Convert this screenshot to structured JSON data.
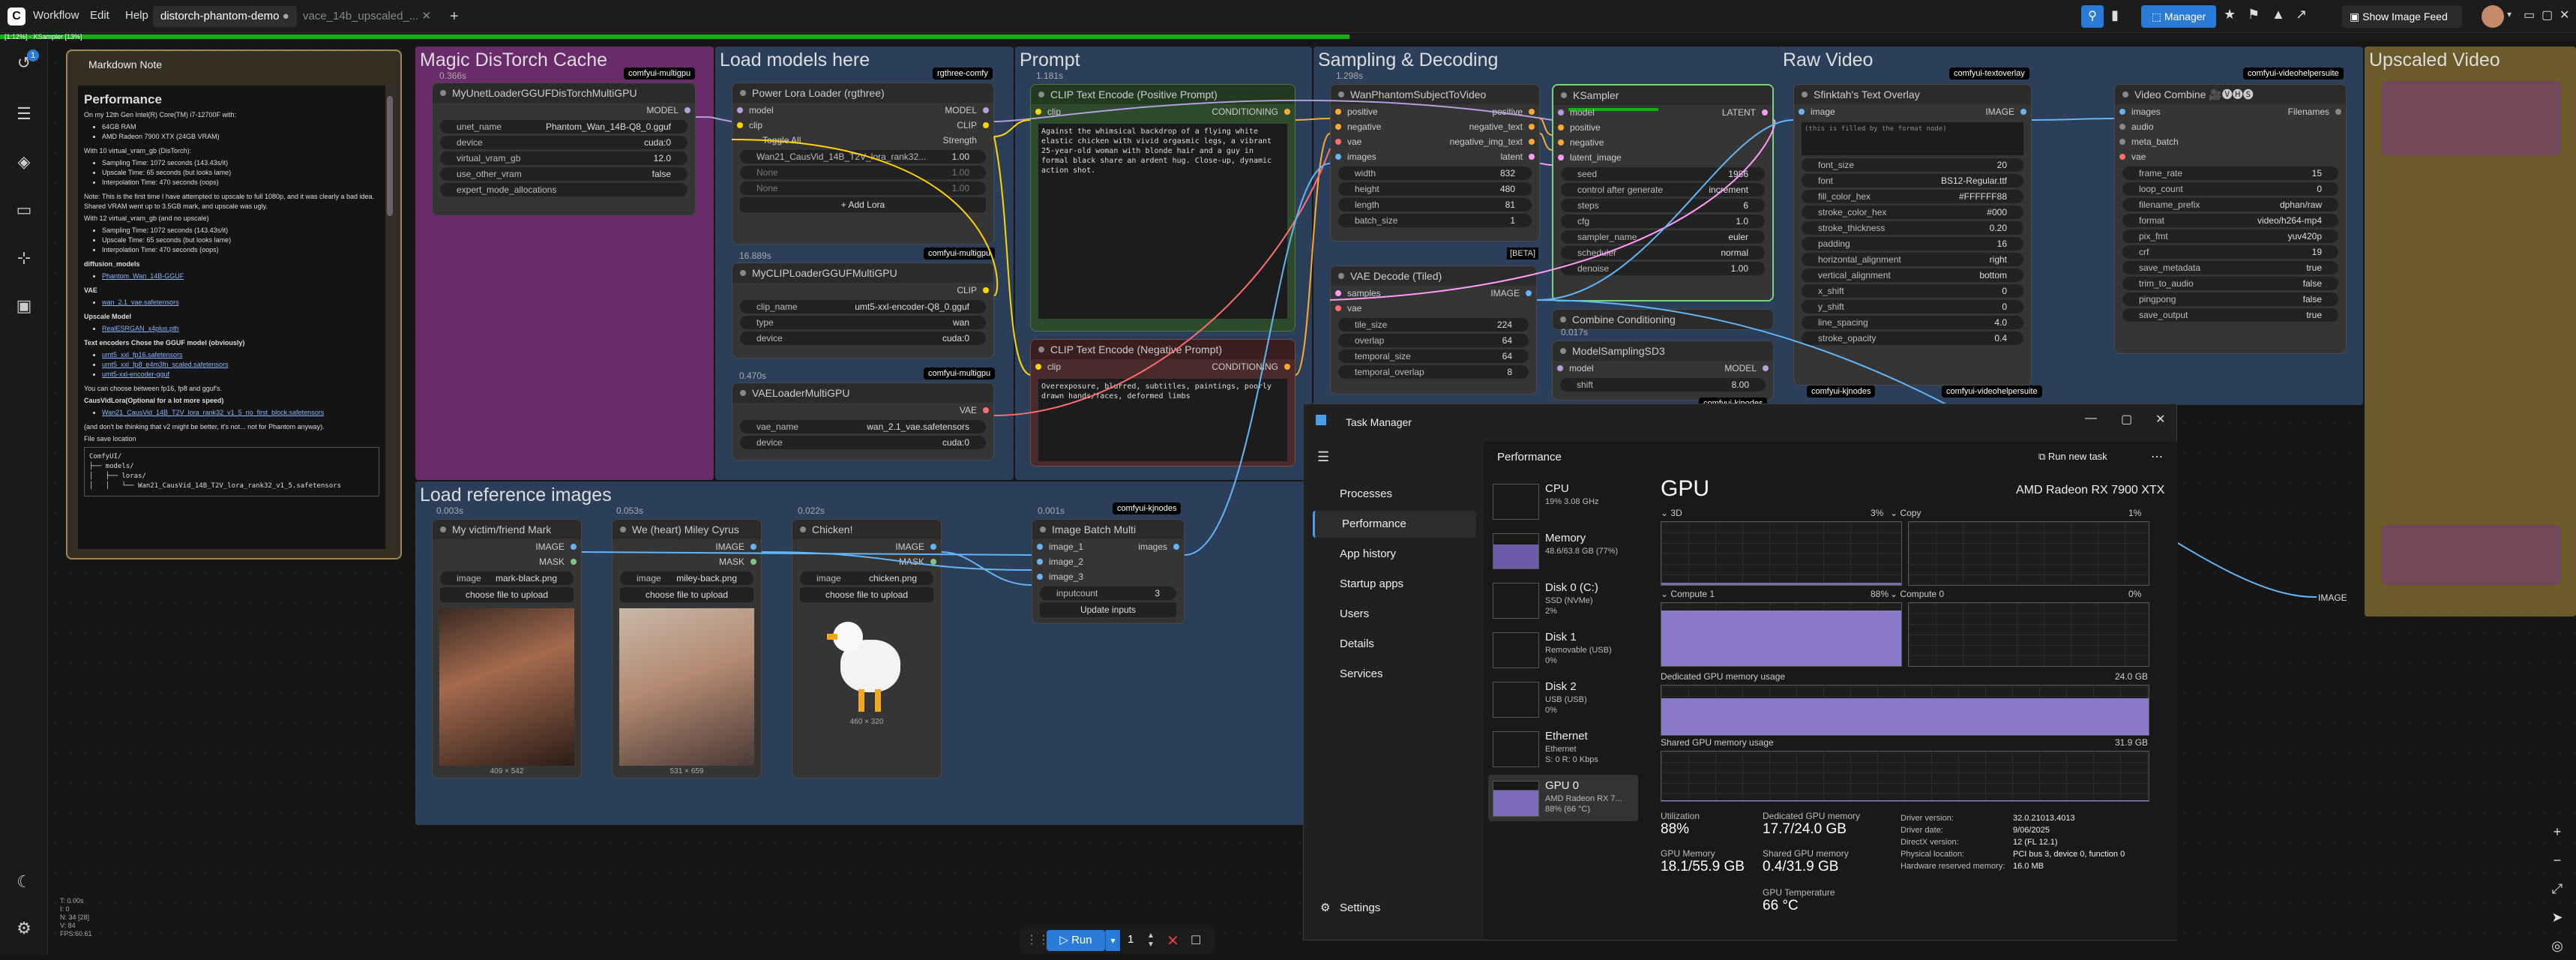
{
  "topbar": {
    "menus": [
      "Workflow",
      "Edit",
      "Help"
    ],
    "tabs": [
      "distorch-phantom-demo",
      "vace_14b_upscaled_..."
    ],
    "manager": "Manager",
    "show_image_feed": "Show Image Feed",
    "progress_text": "[1:12%] - KSampler [13%]"
  },
  "rail": {
    "badge": "1",
    "bottom_stats": [
      "T: 0.00s",
      "I: 0",
      "N: 34 [28]",
      "V: 84",
      "FPS:60.61"
    ]
  },
  "groups": {
    "magic": "Magic DisTorch Cache",
    "load_models": "Load models here",
    "prompt": "Prompt",
    "sampling": "Sampling & Decoding",
    "raw_video": "Raw Video",
    "upscaled": "Upscaled Video",
    "load_ref": "Load reference images"
  },
  "note": {
    "header": "Markdown Note",
    "title": "Performance",
    "intro": "On my 12th Gen Intel(R) Core(TM) i7-12700F with:",
    "specs": [
      "64GB RAM",
      "AMD Radeon 7900 XTX (24GB VRAM)"
    ],
    "v10": "With 10 virtual_vram_gb (DisTorch):",
    "times10": [
      "Sampling Time: 1072 seconds (143.43s/it)",
      "Upscale Time: 65 seconds (but looks lame)",
      "Interpolation Time: 470 seconds (oops)"
    ],
    "note_line": "Note: This is the first time I have attempted to upscale to full 1080p, and it was clearly a bad idea. Shared VRAM went up to 3.5GB mark, and upscale was ugly.",
    "v12": "With 12 virtual_vram_gb (and no upscale)",
    "times12": [
      "Sampling Time: 1072 seconds (143.43s/it)",
      "Upscale Time: 65 seconds (but looks lame)",
      "Interpolation Time: 470 seconds (oops)"
    ],
    "diff_h": "diffusion_models",
    "diff_link": "Phantom_Wan_14B-GGUF",
    "vae_h": "VAE",
    "vae_link": "wan_2.1_vae.safetensors",
    "ups_h": "Upscale Model",
    "ups_link": "RealESRGAN_x4plus.pth",
    "te_h": "Text encoders Chose the GGUF model (obviously)",
    "te_links": [
      "umt5_xxl_fp16.safetensors",
      "umt5_xxl_fp8_e4m3fn_scaled.safetensors",
      "umt5-xxl-encoder-gguf"
    ],
    "fp_line": "You can choose between fp16, fp8 and gguf's.",
    "lora_h": "CausVidLora(Optional for a lot more speed)",
    "lora_link": "Wan21_CausVid_14B_T2V_lora_rank32_v1_5_no_first_block.safetensors",
    "v2_line": "(and don't be thinking that v2 might be better, it's not... not for Phantom anyway).",
    "loc_h": "File save location",
    "tree": "ComfyUI/\n├── models/\n│   ├── loras/\n│   │   └── Wan21_CausVid_14B_T2V_lora_rank32_v1_5.safetensors"
  },
  "nodes": {
    "unet": {
      "badge": "comfyui-multigpu",
      "timing": "0.366s",
      "title": "MyUnetLoaderGGUFDisTorchMultiGPU",
      "out": "MODEL",
      "widgets": [
        [
          "unet_name",
          "Phantom_Wan_14B-Q8_0.gguf"
        ],
        [
          "device",
          "cuda:0"
        ],
        [
          "virtual_vram_gb",
          "12.0"
        ],
        [
          "use_other_vram",
          "false"
        ],
        [
          "expert_mode_allocations",
          ""
        ]
      ]
    },
    "lora": {
      "badge": "rgthree-comfy",
      "title": "Power Lora Loader (rgthree)",
      "in": [
        "model",
        "clip"
      ],
      "out": [
        "MODEL",
        "CLIP"
      ],
      "toggle": "Toggle All",
      "strength": "Strength",
      "lora1": "Wan21_CausVid_14B_T2V_lora_rank32...",
      "lora1v": "1.00",
      "none": "None",
      "nonev": "1.00",
      "add": "+ Add Lora"
    },
    "clip": {
      "badge": "comfyui-multigpu",
      "timing": "16.889s",
      "title": "MyCLIPLoaderGGUFMultiGPU",
      "out": "CLIP",
      "widgets": [
        [
          "clip_name",
          "umt5-xxl-encoder-Q8_0.gguf"
        ],
        [
          "type",
          "wan"
        ],
        [
          "device",
          "cuda:0"
        ]
      ]
    },
    "vae": {
      "badge": "comfyui-multigpu",
      "timing": "0.470s",
      "title": "VAELoaderMultiGPU",
      "out": "VAE",
      "widgets": [
        [
          "vae_name",
          "wan_2.1_vae.safetensors"
        ],
        [
          "device",
          "cuda:0"
        ]
      ]
    },
    "pos": {
      "timing": "1.181s",
      "title": "CLIP Text Encode (Positive Prompt)",
      "in": "clip",
      "out": "CONDITIONING",
      "text": "Against the whimsical backdrop of a flying white elastic chicken with vivid orgasmic legs, a vibrant 25-year-old woman with blonde hair and a guy in formal black share an ardent hug. Close-up, dynamic action shot."
    },
    "neg": {
      "title": "CLIP Text Encode (Negative Prompt)",
      "in": "clip",
      "out": "CONDITIONING",
      "text": "Overexposure, blurred, subtitles, paintings, poorly drawn hands/faces, deformed limbs"
    },
    "wan": {
      "timing": "1.298s",
      "title": "WanPhantomSubjectToVideo",
      "in": [
        "positive",
        "negative",
        "vae",
        "images"
      ],
      "out": [
        "positive",
        "negative_text",
        "negative_img_text",
        "latent"
      ],
      "widgets": [
        [
          "width",
          "832"
        ],
        [
          "height",
          "480"
        ],
        [
          "length",
          "81"
        ],
        [
          "batch_size",
          "1"
        ]
      ],
      "beta": "[BETA]"
    },
    "ks": {
      "title": "KSampler",
      "in": [
        "model",
        "positive",
        "negative",
        "latent_image"
      ],
      "out": "LATENT",
      "widgets": [
        [
          "seed",
          "1986"
        ],
        [
          "control after generate",
          "increment"
        ],
        [
          "steps",
          "6"
        ],
        [
          "cfg",
          "1.0"
        ],
        [
          "sampler_name",
          "euler"
        ],
        [
          "scheduler",
          "normal"
        ],
        [
          "denoise",
          "1.00"
        ]
      ]
    },
    "vaed": {
      "title": "VAE Decode (Tiled)",
      "in": [
        "samples",
        "vae"
      ],
      "out": "IMAGE",
      "widgets": [
        [
          "tile_size",
          "224"
        ],
        [
          "overlap",
          "64"
        ],
        [
          "temporal_size",
          "64"
        ],
        [
          "temporal_overlap",
          "8"
        ]
      ]
    },
    "combine": {
      "title": "Combine Conditioning",
      "timing": "0.017s"
    },
    "msd3": {
      "title": "ModelSamplingSD3",
      "in": "model",
      "out": "MODEL",
      "widgets": [
        [
          "shift",
          "8.00"
        ]
      ],
      "badge": "comfyui-kjnodes"
    },
    "overlay": {
      "badge": "comfyui-textoverlay",
      "title": "Sfinktah's Text Overlay",
      "in": "image",
      "out": "IMAGE",
      "filler": "(this is filled by the format node)",
      "widgets": [
        [
          "font_size",
          "20"
        ],
        [
          "font",
          "BS12-Regular.ttf"
        ],
        [
          "fill_color_hex",
          "#FFFFFF88"
        ],
        [
          "stroke_color_hex",
          "#000"
        ],
        [
          "stroke_thickness",
          "0.20"
        ],
        [
          "padding",
          "16"
        ],
        [
          "horizontal_alignment",
          "right"
        ],
        [
          "vertical_alignment",
          "bottom"
        ],
        [
          "x_shift",
          "0"
        ],
        [
          "y_shift",
          "0"
        ],
        [
          "line_spacing",
          "4.0"
        ],
        [
          "stroke_opacity",
          "0.4"
        ]
      ],
      "badge2": "comfyui-kjnodes",
      "badge3": "comfyui-videohelpersuite"
    },
    "vcombine": {
      "badge": "comfyui-videohelpersuite",
      "title": "Video Combine 🎥🅥🅗🅢",
      "in": [
        "images",
        "audio",
        "meta_batch",
        "vae"
      ],
      "out": "Filenames",
      "widgets": [
        [
          "frame_rate",
          "15"
        ],
        [
          "loop_count",
          "0"
        ],
        [
          "filename_prefix",
          "dphan/raw"
        ],
        [
          "format",
          "video/h264-mp4"
        ],
        [
          "pix_fmt",
          "yuv420p"
        ],
        [
          "crf",
          "19"
        ],
        [
          "save_metadata",
          "true"
        ],
        [
          "trim_to_audio",
          "false"
        ],
        [
          "pingpong",
          "false"
        ],
        [
          "save_output",
          "true"
        ]
      ]
    },
    "img1": {
      "timing": "0.003s",
      "title": "My victim/friend Mark",
      "out": [
        "IMAGE",
        "MASK"
      ],
      "image": "mark-black.png",
      "upload": "choose file to upload",
      "dims": "409 × 542"
    },
    "img2": {
      "timing": "0.053s",
      "title": "We (heart) Miley Cyrus",
      "out": [
        "IMAGE",
        "MASK"
      ],
      "image": "miley-back.png",
      "upload": "choose file to upload",
      "dims": "531 × 659"
    },
    "img3": {
      "timing": "0.022s",
      "title": "Chicken!",
      "out": [
        "IMAGE",
        "MASK"
      ],
      "image": "chicken.png",
      "upload": "choose file to upload",
      "dims": "460 × 320"
    },
    "batch": {
      "timing": "0.001s",
      "badge": "comfyui-kjnodes",
      "title": "Image Batch Multi",
      "in": [
        "image_1",
        "image_2",
        "image_3"
      ],
      "out": "images",
      "inputcount": [
        "inputcount",
        "3"
      ],
      "button": "Update inputs"
    },
    "up_image": "IMAGE"
  },
  "runbar": {
    "run": "Run",
    "count": "1"
  },
  "taskmanager": {
    "title": "Task Manager",
    "nav": [
      "Processes",
      "Performance",
      "App history",
      "Startup apps",
      "Users",
      "Details",
      "Services"
    ],
    "settings": "Settings",
    "section": "Performance",
    "run_task": "Run new task",
    "devices": [
      {
        "name": "CPU",
        "l2": "19% 3.08 GHz",
        "l3": ""
      },
      {
        "name": "Memory",
        "l2": "48.6/63.8 GB (77%)",
        "l3": ""
      },
      {
        "name": "Disk 0 (C:)",
        "l2": "SSD (NVMe)",
        "l3": "2%"
      },
      {
        "name": "Disk 1",
        "l2": "Removable (USB)",
        "l3": "0%"
      },
      {
        "name": "Disk 2",
        "l2": "USB (USB)",
        "l3": "0%"
      },
      {
        "name": "Ethernet",
        "l2": "Ethernet",
        "l3": "S: 0 R: 0 Kbps"
      },
      {
        "name": "GPU 0",
        "l2": "AMD Radeon RX 7...",
        "l3": "88% (66 °C)"
      }
    ],
    "gpu_title": "GPU",
    "gpu_model": "AMD Radeon RX 7900 XTX",
    "g3d": "3D",
    "g3d_pct": "3%",
    "gcopy": "Copy",
    "gcopy_pct": "1%",
    "gc1": "Compute 1",
    "gc1_pct": "88%",
    "gc0": "Compute 0",
    "gc0_pct": "0%",
    "ded_label": "Dedicated GPU memory usage",
    "ded_max": "24.0 GB",
    "shr_label": "Shared GPU memory usage",
    "shr_max": "31.9 GB",
    "stats": {
      "util_k": "Utilization",
      "util_v": "88%",
      "gmem_k": "GPU Memory",
      "gmem_v": "18.1/55.9 GB",
      "dmem_k": "Dedicated GPU memory",
      "dmem_v": "17.7/24.0 GB",
      "smem_k": "Shared GPU memory",
      "smem_v": "0.4/31.9 GB",
      "temp_k": "GPU Temperature",
      "temp_v": "66 °C"
    },
    "info": [
      [
        "Driver version:",
        "32.0.21013.4013"
      ],
      [
        "Driver date:",
        "9/06/2025"
      ],
      [
        "DirectX version:",
        "12 (FL 12.1)"
      ],
      [
        "Physical location:",
        "PCI bus 3, device 0, function 0"
      ],
      [
        "Hardware reserved memory:",
        "16.0 MB"
      ]
    ],
    "usage": {
      "gpu3d": 0.03,
      "compute1": 0.88,
      "dedicated": 0.74,
      "shared": 0.01
    }
  },
  "colors": {
    "accent": "#2a7bd8",
    "progress": "#12b012",
    "prompt_green": "#2d4a2d",
    "prompt_red": "#4a2a2a",
    "note_border": "#a3855a"
  }
}
